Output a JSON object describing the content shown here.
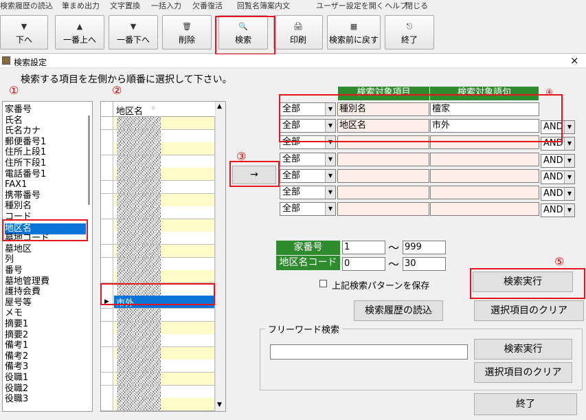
{
  "menu": [
    "検索履歴の読込",
    "筆まめ出力",
    "文字置換",
    "一括入力",
    "欠番復活",
    "回覧名簿案内文",
    "ユーザー設定を開く",
    "ヘルプ",
    "閉じる"
  ],
  "toolbar": {
    "down": "下へ",
    "top": "一番上へ",
    "bottom": "一番下へ",
    "delete": "削除",
    "search": "検索",
    "print": "印刷",
    "back": "検索前に戻す",
    "exit": "終了"
  },
  "window": {
    "title": "検索設定",
    "close": "×"
  },
  "instruction": "検索する項目を左側から順番に選択して下さい。",
  "markers": {
    "m1": "①",
    "m2": "②",
    "m3": "③",
    "m4": "④",
    "m5": "⑤"
  },
  "fields": [
    "家番号",
    "氏名",
    "氏名カナ",
    "郵便番号1",
    "住所上段1",
    "住所下段1",
    "電話番号1",
    "FAX1",
    "携帯番号",
    "種別名",
    "コード",
    "地区名",
    "墓地コード",
    "墓地区",
    "列",
    "番号",
    "墓地管理費",
    "護持会費",
    "屋号等",
    "メモ",
    "摘要1",
    "摘要2",
    "備考1",
    "備考2",
    "備考3",
    "役職1",
    "役職2",
    "役職3"
  ],
  "selected_field": "地区名",
  "values_column_header": "地区名",
  "selected_value": "市外",
  "arrow_button": "→",
  "criteria_header": {
    "item": "検索対象項目",
    "term": "検索対象語句"
  },
  "criteria": [
    {
      "scope": "全部",
      "item": "種別名",
      "term": "檀家",
      "logic": ""
    },
    {
      "scope": "全部",
      "item": "地区名",
      "term": "市外",
      "logic": "AND"
    },
    {
      "scope": "全部",
      "item": "",
      "term": "",
      "logic": "AND"
    },
    {
      "scope": "全部",
      "item": "",
      "term": "",
      "logic": "AND"
    },
    {
      "scope": "全部",
      "item": "",
      "term": "",
      "logic": "AND"
    },
    {
      "scope": "全部",
      "item": "",
      "term": "",
      "logic": "AND"
    },
    {
      "scope": "全部",
      "item": "",
      "term": "",
      "logic": "AND"
    }
  ],
  "range": {
    "house_label": "家番号",
    "house_from": "1",
    "house_to": "999",
    "area_label": "地区名コード",
    "area_from": "0",
    "area_to": "30",
    "tilde": "～"
  },
  "save_pattern": "上記検索パターンを保存",
  "buttons": {
    "execute": "検索実行",
    "history": "検索履歴の読込",
    "clear": "選択項目のクリア",
    "fw_execute": "検索実行",
    "fw_clear": "選択項目のクリア",
    "end": "終了"
  },
  "freeword": {
    "label": "フリーワード検索",
    "value": ""
  },
  "colors": {
    "selection": "#0a74d9",
    "highlight_box": "#e8141c",
    "header_green": "#2e8b2e",
    "row_pink": "#fdeeea",
    "row_yellow": "#fffbc9"
  }
}
